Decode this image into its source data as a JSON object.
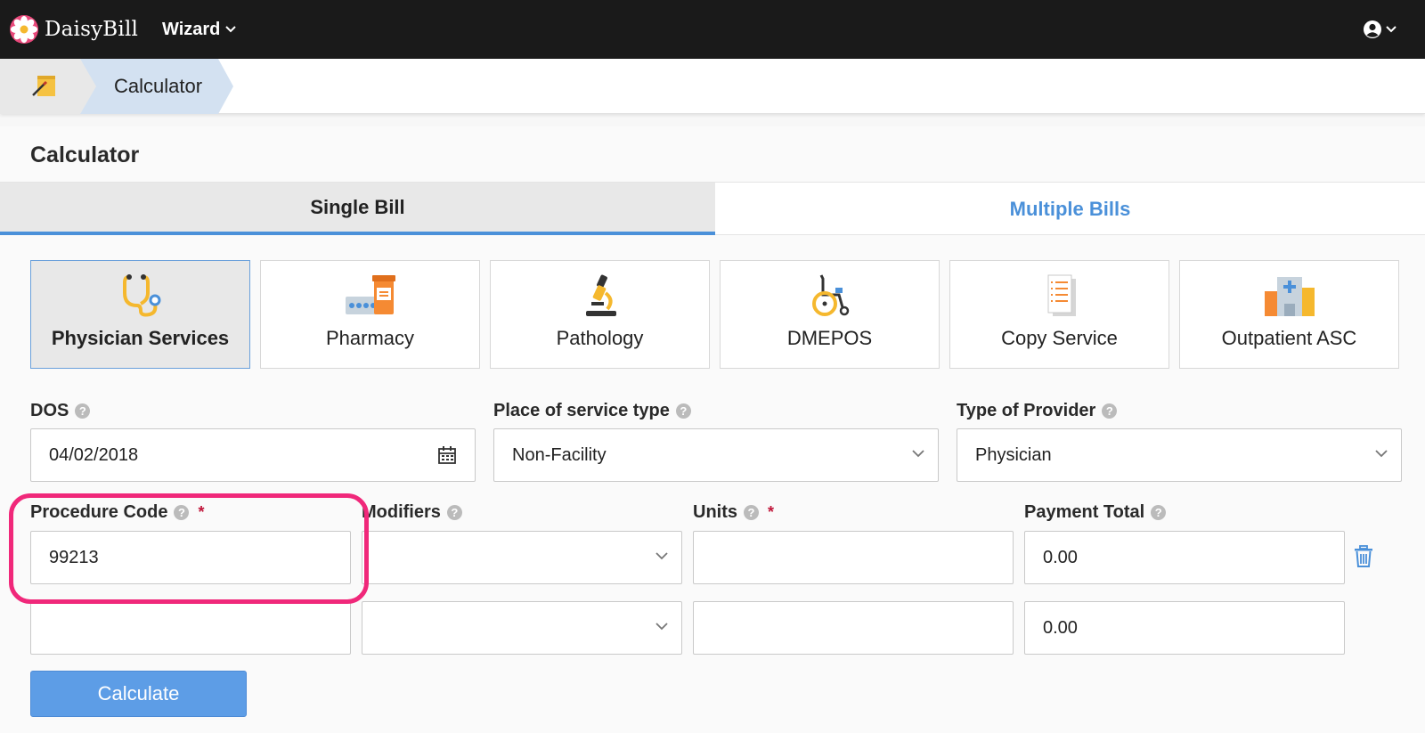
{
  "app": {
    "brand": "DaisyBill",
    "menu_label": "Wizard"
  },
  "breadcrumb": {
    "current": "Calculator"
  },
  "page": {
    "title": "Calculator"
  },
  "tabs": [
    {
      "label": "Single Bill",
      "active": true
    },
    {
      "label": "Multiple Bills",
      "active": false
    }
  ],
  "categories": [
    {
      "label": "Physician Services",
      "icon": "stethoscope-icon",
      "active": true
    },
    {
      "label": "Pharmacy",
      "icon": "pharmacy-icon",
      "active": false
    },
    {
      "label": "Pathology",
      "icon": "microscope-icon",
      "active": false
    },
    {
      "label": "DMEPOS",
      "icon": "wheelchair-icon",
      "active": false
    },
    {
      "label": "Copy Service",
      "icon": "document-copy-icon",
      "active": false
    },
    {
      "label": "Outpatient ASC",
      "icon": "hospital-icon",
      "active": false
    }
  ],
  "form": {
    "dos": {
      "label": "DOS",
      "value": "04/02/2018"
    },
    "place_of_service": {
      "label": "Place of service type",
      "value": "Non-Facility"
    },
    "provider_type": {
      "label": "Type of Provider",
      "value": "Physician"
    },
    "columns": {
      "procedure_code": "Procedure Code",
      "modifiers": "Modifiers",
      "units": "Units",
      "payment_total": "Payment Total",
      "required_mark": "*",
      "help_mark": "?"
    },
    "rows": [
      {
        "procedure_code": "99213",
        "modifier": "",
        "units": "",
        "payment_total": "0.00"
      },
      {
        "procedure_code": "",
        "modifier": "",
        "units": "",
        "payment_total": "0.00"
      }
    ],
    "calculate_label": "Calculate"
  },
  "colors": {
    "accent": "#4a90d9",
    "button": "#5d9de6",
    "highlight": "#f0287a",
    "topbar": "#1a1a1a"
  }
}
